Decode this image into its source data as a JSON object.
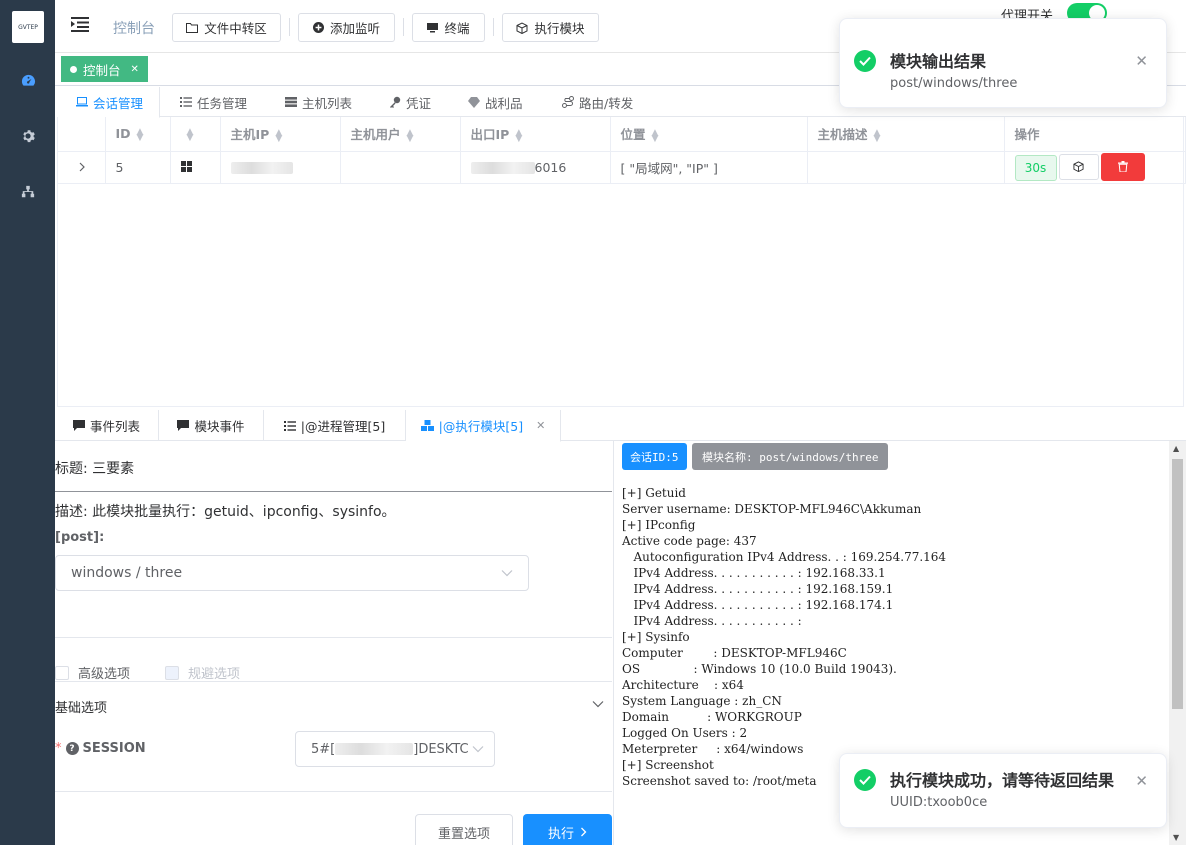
{
  "sidebar": {
    "logo_text": "GVTEP",
    "icons": [
      "dashboard-icon",
      "gear-icon",
      "sitemap-icon"
    ]
  },
  "topbar": {
    "breadcrumb": "控制台",
    "buttons": {
      "file_transfer": "文件中转区",
      "add_listener": "添加监听",
      "terminal": "终端",
      "exec_module": "执行模块"
    },
    "proxy_switch_label": "代理开关",
    "proxy_switch_on": true
  },
  "tags": {
    "active": "控制台"
  },
  "section_tabs": [
    {
      "label": "会话管理",
      "icon": "laptop-icon"
    },
    {
      "label": "任务管理",
      "icon": "list-icon"
    },
    {
      "label": "主机列表",
      "icon": "server-icon"
    },
    {
      "label": "凭证",
      "icon": "key-icon"
    },
    {
      "label": "战利品",
      "icon": "loot-icon"
    },
    {
      "label": "路由/转发",
      "icon": "route-icon"
    }
  ],
  "table": {
    "columns": [
      "ID",
      "",
      "主机IP",
      "主机用户",
      "出口IP",
      "位置",
      "主机描述",
      "操作"
    ],
    "rows": [
      {
        "id": "5",
        "os_icon": "windows-icon",
        "host_ip": "",
        "host_user": "",
        "egress_ip_suffix": "6016",
        "location": "[ \"局域网\", \"IP\" ]",
        "description": "",
        "timer": "30s"
      }
    ]
  },
  "bottom_tabs": [
    {
      "label": "事件列表",
      "icon": "comment-icon"
    },
    {
      "label": "模块事件",
      "icon": "comment-icon"
    },
    {
      "label": "|@进程管理[5]",
      "icon": "list-icon"
    },
    {
      "label": "|@执行模块[5]",
      "icon": "cubes-icon",
      "active": true
    }
  ],
  "form": {
    "title": "标题: 三要素",
    "description": "描述: 此模块批量执行：getuid、ipconfig、sysinfo。",
    "post_label": "[post]:",
    "module_select": "windows / three",
    "advanced_option": "高级选项",
    "evasion_option": "规避选项",
    "basic_options": "基础选项",
    "session_label": "SESSION",
    "session_value_prefix": "5#[",
    "session_value_suffix": "]DESKTC",
    "reset_button": "重置选项",
    "execute_button": "执行"
  },
  "output": {
    "session_tag": "会话ID:5",
    "module_tag": "模块名称: post/windows/three",
    "lines": [
      "[+] Getuid",
      "Server username: DESKTOP-MFL946C\\Akkuman",
      "[+] IPconfig",
      "Active code page: 437",
      "   Autoconfiguration IPv4 Address. . : 169.254.77.164",
      "   IPv4 Address. . . . . . . . . . . : 192.168.33.1",
      "   IPv4 Address. . . . . . . . . . . : 192.168.159.1",
      "   IPv4 Address. . . . . . . . . . . : 192.168.174.1",
      "   IPv4 Address. . . . . . . . . . . :",
      "[+] Sysinfo",
      "Computer        : DESKTOP-MFL946C",
      "OS              : Windows 10 (10.0 Build 19043).",
      "Architecture    : x64",
      "System Language : zh_CN",
      "Domain          : WORKGROUP",
      "Logged On Users : 2",
      "Meterpreter     : x64/windows",
      "[+] Screenshot",
      "Screenshot saved to: /root/meta"
    ]
  },
  "notifications": [
    {
      "title": "模块输出结果",
      "message": "post/windows/three"
    },
    {
      "title": "执行模块成功，请等待返回结果",
      "message": "UUID:txoob0ce"
    }
  ],
  "colors": {
    "accent": "#1890ff",
    "success": "#13ce66",
    "danger": "#f23b3b",
    "sidebar": "#2b3a4a",
    "tag": "#42b983"
  }
}
